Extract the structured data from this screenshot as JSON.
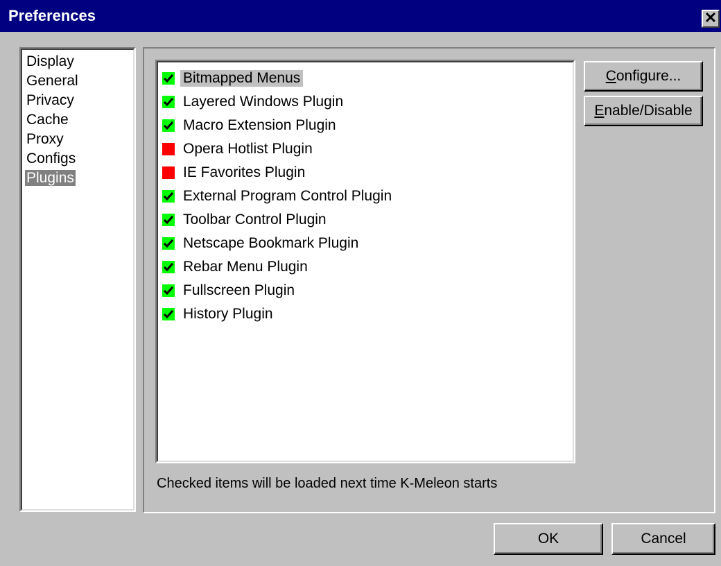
{
  "window": {
    "title": "Preferences",
    "close_glyph": "✕"
  },
  "categories": [
    {
      "label": "Display",
      "selected": false
    },
    {
      "label": "General",
      "selected": false
    },
    {
      "label": "Privacy",
      "selected": false
    },
    {
      "label": "Cache",
      "selected": false
    },
    {
      "label": "Proxy",
      "selected": false
    },
    {
      "label": "Configs",
      "selected": false
    },
    {
      "label": "Plugins",
      "selected": true
    }
  ],
  "plugins": [
    {
      "label": "Bitmapped Menus",
      "enabled": true,
      "selected": true
    },
    {
      "label": "Layered Windows Plugin",
      "enabled": true,
      "selected": false
    },
    {
      "label": "Macro Extension Plugin",
      "enabled": true,
      "selected": false
    },
    {
      "label": "Opera Hotlist Plugin",
      "enabled": false,
      "selected": false
    },
    {
      "label": "IE Favorites Plugin",
      "enabled": false,
      "selected": false
    },
    {
      "label": "External Program Control Plugin",
      "enabled": true,
      "selected": false
    },
    {
      "label": "Toolbar Control Plugin",
      "enabled": true,
      "selected": false
    },
    {
      "label": "Netscape Bookmark Plugin",
      "enabled": true,
      "selected": false
    },
    {
      "label": "Rebar Menu Plugin",
      "enabled": true,
      "selected": false
    },
    {
      "label": "Fullscreen Plugin",
      "enabled": true,
      "selected": false
    },
    {
      "label": "History Plugin",
      "enabled": true,
      "selected": false
    }
  ],
  "buttons": {
    "configure": {
      "mnemonic": "C",
      "rest": "onfigure..."
    },
    "enable_disable": {
      "mnemonic": "E",
      "rest": "nable/Disable"
    },
    "ok": "OK",
    "cancel": "Cancel"
  },
  "footnote": "Checked items will be loaded next time K-Meleon starts",
  "colors": {
    "enabled_mark": "#00ff00",
    "disabled_mark": "#ff0000",
    "titlebar": "#000080"
  }
}
